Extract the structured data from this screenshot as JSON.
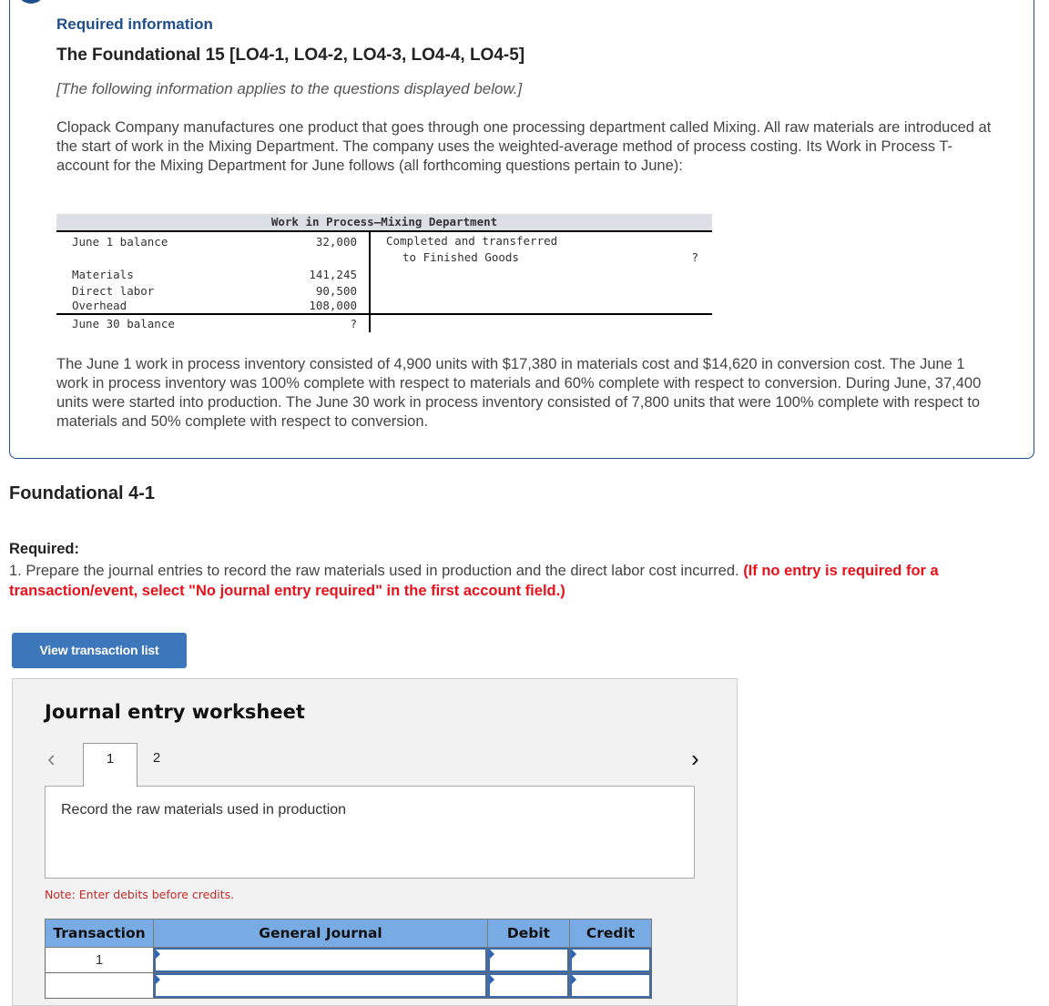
{
  "info": {
    "required_information": "Required information",
    "title": "The Foundational 15 [LO4-1, LO4-2, LO4-3, LO4-4, LO4-5]",
    "applies_note": "[The following information applies to the questions displayed below.]",
    "paragraph1": "Clopack Company manufactures one product that goes through one processing department called Mixing. All raw materials are introduced at the start of work in the Mixing Department. The company uses the weighted-average method of process costing. Its Work in Process T-account for the Mixing Department for June follows (all forthcoming questions pertain to June):",
    "paragraph2": "The June 1 work in process inventory consisted of 4,900 units with $17,380 in materials cost and $14,620 in conversion cost. The June 1 work in process inventory was 100% complete with respect to materials and 60% complete with respect to conversion. During June, 37,400 units were started into production. The June 30 work in process inventory consisted of 7,800 units that were 100% complete with respect to materials and 50% complete with respect to conversion."
  },
  "t_account": {
    "title": "Work in Process—Mixing Department",
    "debits": [
      {
        "label": "June 1 balance",
        "amount": "32,000"
      },
      {
        "label": "Materials",
        "amount": "141,245"
      },
      {
        "label": "Direct labor",
        "amount": "90,500"
      },
      {
        "label": "Overhead",
        "amount": "108,000"
      }
    ],
    "ending": {
      "label": "June 30 balance",
      "amount": "?"
    },
    "credit": {
      "line1": "Completed and transferred",
      "line2": "to Finished Goods",
      "amount": "?"
    }
  },
  "question": {
    "heading": "Foundational 4-1",
    "required_label": "Required:",
    "required_text": "1. Prepare the journal entries to record the raw materials used in production and the direct labor cost incurred. ",
    "required_emphasis": "(If no entry is required for a transaction/event, select \"No journal entry required\" in the first account field.)",
    "view_button": "View transaction list"
  },
  "worksheet": {
    "title": "Journal entry worksheet",
    "prev_icon": "‹",
    "next_icon": "›",
    "tabs": [
      {
        "label": "1",
        "active": true
      },
      {
        "label": "2",
        "active": false
      }
    ],
    "description": "Record the raw materials used in production",
    "note": "Note: Enter debits before credits.",
    "columns": [
      "Transaction",
      "General Journal",
      "Debit",
      "Credit"
    ],
    "rows": [
      {
        "transaction": "1",
        "account": "",
        "debit": "",
        "credit": ""
      },
      {
        "transaction": "",
        "account": "",
        "debit": "",
        "credit": ""
      }
    ]
  }
}
